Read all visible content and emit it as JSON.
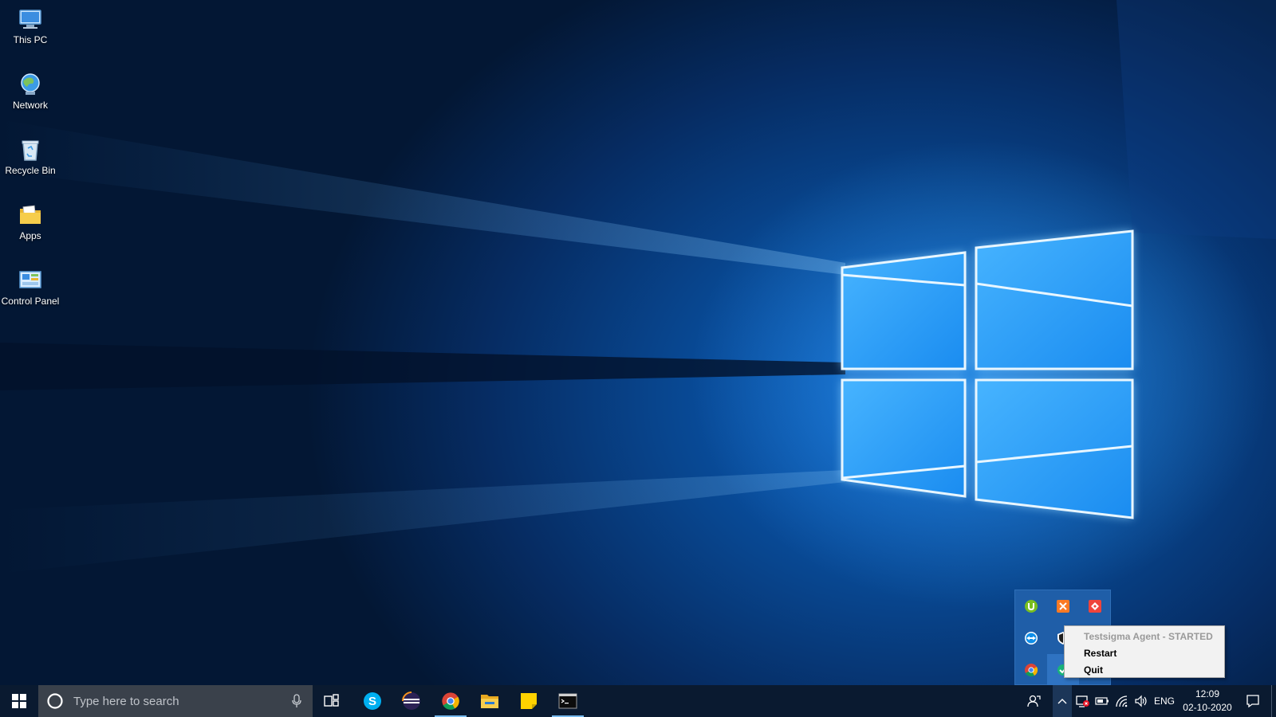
{
  "desktop": {
    "icons": [
      {
        "label": "This PC",
        "icon": "this-pc-icon"
      },
      {
        "label": "Network",
        "icon": "network-icon"
      },
      {
        "label": "Recycle Bin",
        "icon": "recycle-bin-icon"
      },
      {
        "label": "Apps",
        "icon": "folder-icon"
      },
      {
        "label": "Control Panel",
        "icon": "control-panel-icon"
      }
    ]
  },
  "tray_overflow": {
    "icons": [
      "utorrent-icon",
      "xampp-icon",
      "anydesk-icon",
      "teamviewer-icon",
      "shield-icon",
      "chrome-icon",
      "testsigma-agent-icon"
    ]
  },
  "context_menu": {
    "status": "Testsigma Agent - STARTED",
    "restart": "Restart",
    "quit": "Quit"
  },
  "taskbar": {
    "search_placeholder": "Type here to search",
    "apps": [
      "skype-icon",
      "eclipse-icon",
      "chrome-icon",
      "file-explorer-icon",
      "sticky-notes-icon",
      "command-prompt-icon"
    ],
    "active_apps": [
      "chrome-icon",
      "command-prompt-icon"
    ],
    "language": "ENG",
    "time": "12:09",
    "date": "02-10-2020"
  },
  "colors": {
    "taskbar": "#0a1a30",
    "search_box": "#3a414b",
    "tray_flyout": "#1f5ea8",
    "menu_bg": "#f2f2f2",
    "active_indicator": "#76b9ed"
  }
}
